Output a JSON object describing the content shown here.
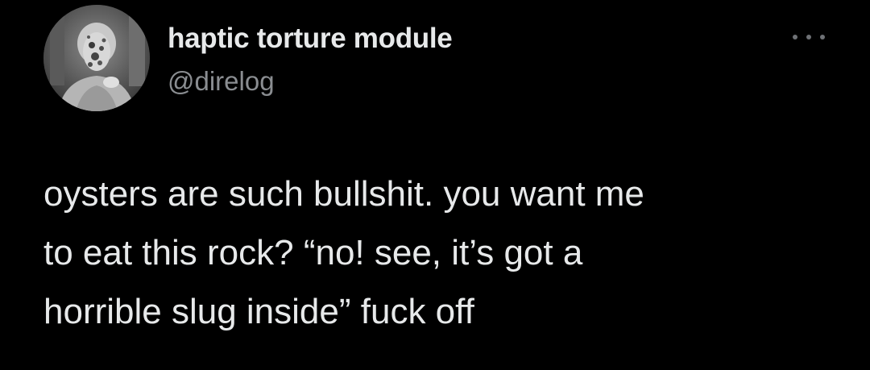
{
  "author": {
    "display_name": "haptic torture module",
    "handle": "@direlog",
    "avatar_icon": "user-avatar-photo"
  },
  "menu": {
    "icon": "more-options-icon"
  },
  "tweet": {
    "lines": [
      "oysters are such bullshit. you want me",
      "to eat this rock? “no! see, it’s got a",
      "horrible slug inside” fuck off"
    ]
  },
  "colors": {
    "background": "#000000",
    "text": "#e7e9ea",
    "secondary": "#8a8d91"
  }
}
